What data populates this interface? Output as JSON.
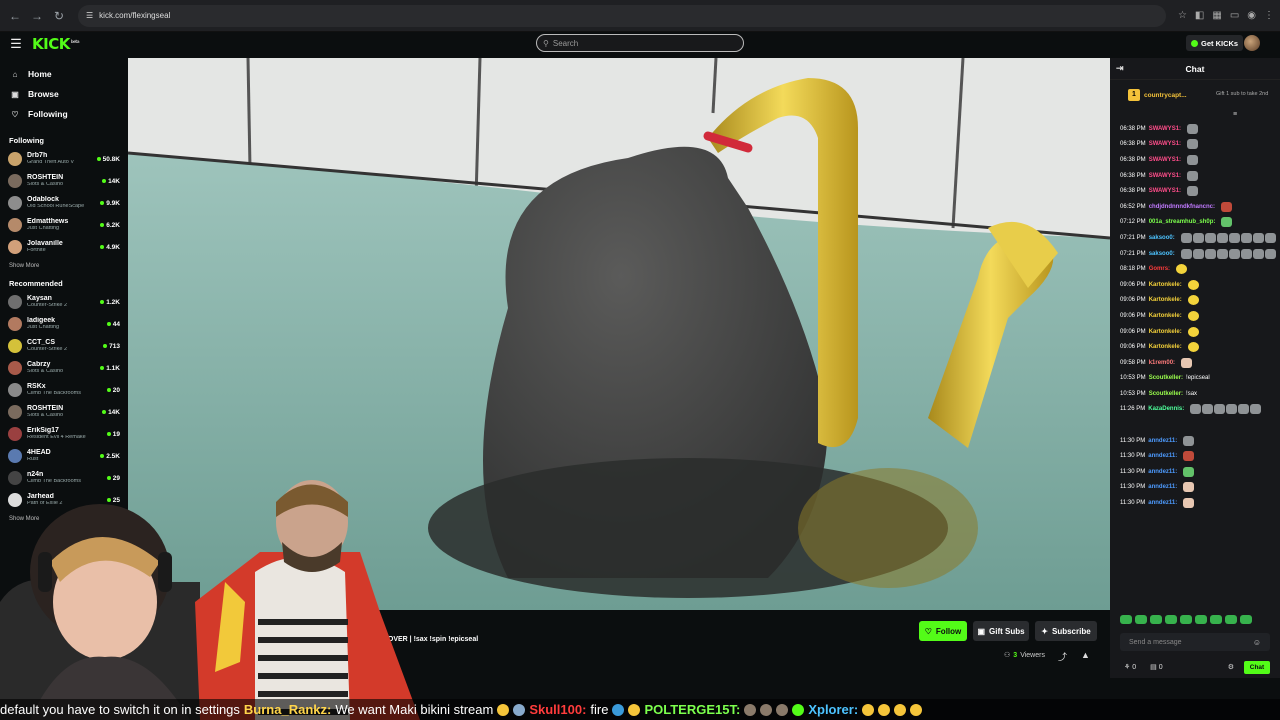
{
  "browser": {
    "url": "kick.com/flexingseal"
  },
  "header": {
    "logo": "KICK",
    "logo_sup": "beta",
    "search_placeholder": "Search",
    "get_kicks": "Get KICKs"
  },
  "sidebar": {
    "nav": [
      {
        "label": "Home",
        "icon": "home-icon"
      },
      {
        "label": "Browse",
        "icon": "compass-icon"
      },
      {
        "label": "Following",
        "icon": "heart-icon"
      }
    ],
    "following_title": "Following",
    "following": [
      {
        "name": "Drb7h",
        "category": "Grand Theft Auto V",
        "viewers": "50.8K",
        "color": "#c9a36b"
      },
      {
        "name": "ROSHTEIN",
        "category": "Slots & Casino",
        "viewers": "14K",
        "color": "#7a6b5e"
      },
      {
        "name": "Odablock",
        "category": "Old School RuneScape",
        "viewers": "9.9K",
        "color": "#8d8d8d"
      },
      {
        "name": "Edmatthews",
        "category": "Just Chatting",
        "viewers": "6.2K",
        "color": "#b58a6a"
      },
      {
        "name": "Jolavanille",
        "category": "Fortnite",
        "viewers": "4.9K",
        "color": "#d2a07a"
      }
    ],
    "show_more": "Show More",
    "recommended_title": "Recommended",
    "recommended": [
      {
        "name": "Kaysan",
        "category": "Counter-Strike 2",
        "viewers": "1.2K",
        "color": "#6f6f6f"
      },
      {
        "name": "ladigeek",
        "category": "Just Chatting",
        "viewers": "44",
        "color": "#b27a60"
      },
      {
        "name": "CCT_CS",
        "category": "Counter-Strike 2",
        "viewers": "713",
        "color": "#d4c13a"
      },
      {
        "name": "Cabrzy",
        "category": "Slots & Casino",
        "viewers": "1.1K",
        "color": "#a85a4a"
      },
      {
        "name": "RSKx",
        "category": "Climb The Backrooms",
        "viewers": "20",
        "color": "#8a8a8a"
      },
      {
        "name": "ROSHTEIN",
        "category": "Slots & Casino",
        "viewers": "14K",
        "color": "#7a6b5e"
      },
      {
        "name": "ErikSig17",
        "category": "Resident Evil 4 Remake",
        "viewers": "19",
        "color": "#9a4040"
      },
      {
        "name": "4HEAD",
        "category": "Rust",
        "viewers": "2.5K",
        "color": "#5a7ab0"
      },
      {
        "name": "n24n",
        "category": "Climb The Backrooms",
        "viewers": "29",
        "color": "#444"
      },
      {
        "name": "Jarhead",
        "category": "Path of Exile 2",
        "viewers": "25",
        "color": "#ddd"
      }
    ],
    "show_more_2": "Show More"
  },
  "stream": {
    "title": "AND RECOVER | !sax !spin !epicseal",
    "follow": "Follow",
    "gift_subs": "Gift Subs",
    "subscribe": "Subscribe",
    "viewers_count": "3",
    "viewers_label": "Viewers"
  },
  "chat": {
    "title": "Chat",
    "pinned": {
      "user": "countrycapt...",
      "level": "1",
      "text": "Gift 1 sub to take 2nd"
    },
    "messages": [
      {
        "time": "06:38 PM",
        "user": "SWAWYS1:",
        "color": "#ff4d8a",
        "text": "",
        "emotes": [
          "grey"
        ]
      },
      {
        "time": "06:38 PM",
        "user": "SWAWYS1:",
        "color": "#ff4d8a",
        "text": "",
        "emotes": [
          "grey"
        ]
      },
      {
        "time": "06:38 PM",
        "user": "SWAWYS1:",
        "color": "#ff4d8a",
        "text": "",
        "emotes": [
          "grey"
        ]
      },
      {
        "time": "06:38 PM",
        "user": "SWAWYS1:",
        "color": "#ff4d8a",
        "text": "",
        "emotes": [
          "grey"
        ]
      },
      {
        "time": "06:38 PM",
        "user": "SWAWYS1:",
        "color": "#ff4d8a",
        "text": "",
        "emotes": [
          "grey"
        ]
      },
      {
        "time": "06:52 PM",
        "user": "chdjdndnnndkfnancnc:",
        "color": "#c07aff",
        "text": "",
        "emotes": [
          "red"
        ]
      },
      {
        "time": "07:12 PM",
        "user": "001a_streamhub_sh0p:",
        "color": "#7cff4d",
        "text": "",
        "emotes": [
          "green"
        ]
      },
      {
        "time": "07:21 PM",
        "user": "saksoo0:",
        "color": "#4dc3ff",
        "text": "",
        "emotes": [
          "grey",
          "grey",
          "grey",
          "grey",
          "grey",
          "grey",
          "grey",
          "grey"
        ]
      },
      {
        "time": "07:21 PM",
        "user": "saksoo0:",
        "color": "#4dc3ff",
        "text": "",
        "emotes": [
          "grey",
          "grey",
          "grey",
          "grey",
          "grey",
          "grey",
          "grey",
          "grey"
        ]
      },
      {
        "time": "08:18 PM",
        "user": "Gomrs:",
        "color": "#ff3c3c",
        "text": "",
        "emotes": [
          "yellow"
        ]
      },
      {
        "time": "09:06 PM",
        "user": "Kartonkele:",
        "color": "#f4d13a",
        "text": "",
        "emotes": [
          "yellow"
        ]
      },
      {
        "time": "09:06 PM",
        "user": "Kartonkele:",
        "color": "#f4d13a",
        "text": "",
        "emotes": [
          "yellow"
        ]
      },
      {
        "time": "09:06 PM",
        "user": "Kartonkele:",
        "color": "#f4d13a",
        "text": "",
        "emotes": [
          "yellow"
        ]
      },
      {
        "time": "09:06 PM",
        "user": "Kartonkele:",
        "color": "#f4d13a",
        "text": "",
        "emotes": [
          "yellow"
        ]
      },
      {
        "time": "09:06 PM",
        "user": "Kartonkele:",
        "color": "#f4d13a",
        "text": "",
        "emotes": [
          "yellow"
        ]
      },
      {
        "time": "09:58 PM",
        "user": "k1rem00:",
        "color": "#ff7b7b",
        "text": "",
        "emotes": [
          "pink"
        ]
      },
      {
        "time": "10:53 PM",
        "user": "Scoutkeller:",
        "color": "#9bff4d",
        "text": "!epicseal",
        "emotes": []
      },
      {
        "time": "10:53 PM",
        "user": "Scoutkeller:",
        "color": "#9bff4d",
        "text": "!sax",
        "emotes": []
      },
      {
        "time": "11:26 PM",
        "user": "KazaDennis:",
        "color": "#4dff9b",
        "text": "",
        "emotes": [
          "grey",
          "grey",
          "grey",
          "grey",
          "grey",
          "grey"
        ]
      },
      {
        "time": "",
        "user": "",
        "color": "#fff",
        "text": "",
        "emotes": []
      },
      {
        "time": "11:30 PM",
        "user": "anndez11:",
        "color": "#4d9bff",
        "text": "",
        "emotes": [
          "grey"
        ]
      },
      {
        "time": "11:30 PM",
        "user": "anndez11:",
        "color": "#4d9bff",
        "text": "",
        "emotes": [
          "red"
        ]
      },
      {
        "time": "11:30 PM",
        "user": "anndez11:",
        "color": "#4d9bff",
        "text": "",
        "emotes": [
          "green"
        ]
      },
      {
        "time": "11:30 PM",
        "user": "anndez11:",
        "color": "#4d9bff",
        "text": "",
        "emotes": [
          "pink"
        ]
      },
      {
        "time": "11:30 PM",
        "user": "anndez11:",
        "color": "#4d9bff",
        "text": "",
        "emotes": [
          "pink"
        ]
      }
    ],
    "input_placeholder": "Send a message",
    "footer_left": "0",
    "footer_mid": "0",
    "send": "Chat"
  },
  "ticker": {
    "text1": "default you have to switch it on in settings",
    "user2": "Burna_Rankz:",
    "user2_color": "#ffd54a",
    "text2": "We want Maki bikini stream",
    "user3": "Skull100:",
    "user3_color": "#ff3c3c",
    "text3": "fire",
    "user4": "POLTERGE15T:",
    "user4_color": "#7cff4d",
    "user5": "Xplorer:",
    "user5_color": "#4dc3ff"
  },
  "colors": {
    "accent": "#53fc18"
  }
}
